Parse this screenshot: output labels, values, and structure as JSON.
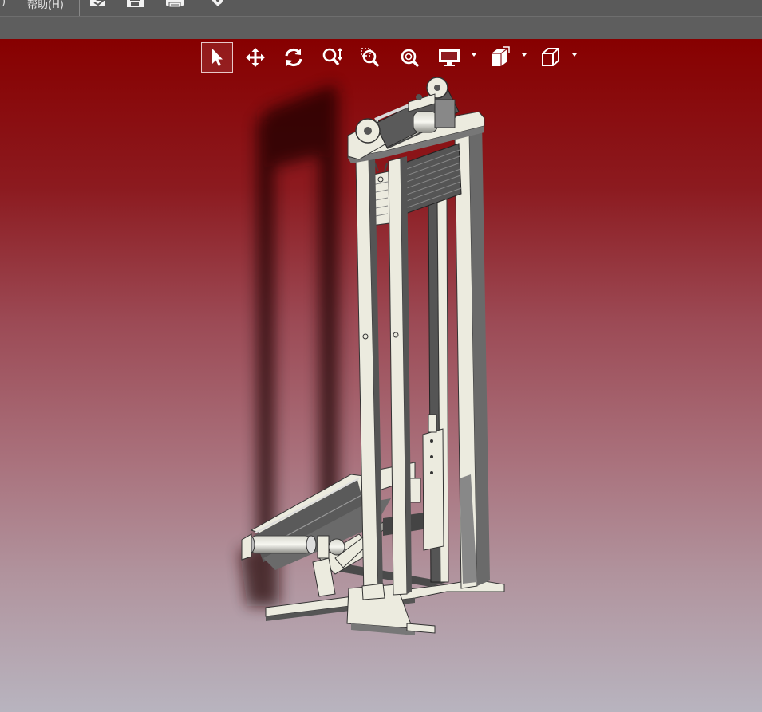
{
  "menu": {
    "left_fragment": ")",
    "help_label": "帮助(H)"
  },
  "toolbar": {
    "icons": [
      "open-icon",
      "save-icon",
      "print-icon",
      "settings-icon"
    ]
  },
  "view_toolbar": {
    "tools": [
      {
        "name": "select-tool",
        "icon": "cursor-arrow-icon",
        "active": true
      },
      {
        "name": "pan-tool",
        "icon": "move-arrows-icon"
      },
      {
        "name": "rotate-tool",
        "icon": "rotate-icon"
      },
      {
        "name": "zoom-tool",
        "icon": "zoom-updown-icon"
      },
      {
        "name": "zoom-window-tool",
        "icon": "zoom-window-icon"
      },
      {
        "name": "zoom-fit-tool",
        "icon": "zoom-fit-icon"
      },
      {
        "name": "display-style-tool",
        "icon": "monitor-icon",
        "dropdown": true
      },
      {
        "name": "section-view-tool",
        "icon": "section-cube-icon",
        "dropdown": true
      },
      {
        "name": "view-orientation-tool",
        "icon": "cube-view-icon",
        "dropdown": true
      }
    ]
  },
  "viewport": {
    "background_top": "#870000",
    "background_bottom": "#b8b4bf",
    "model_color": "#ecebdf",
    "model_dark": "#4a4a4a",
    "model_mid": "#8a8a8a"
  }
}
